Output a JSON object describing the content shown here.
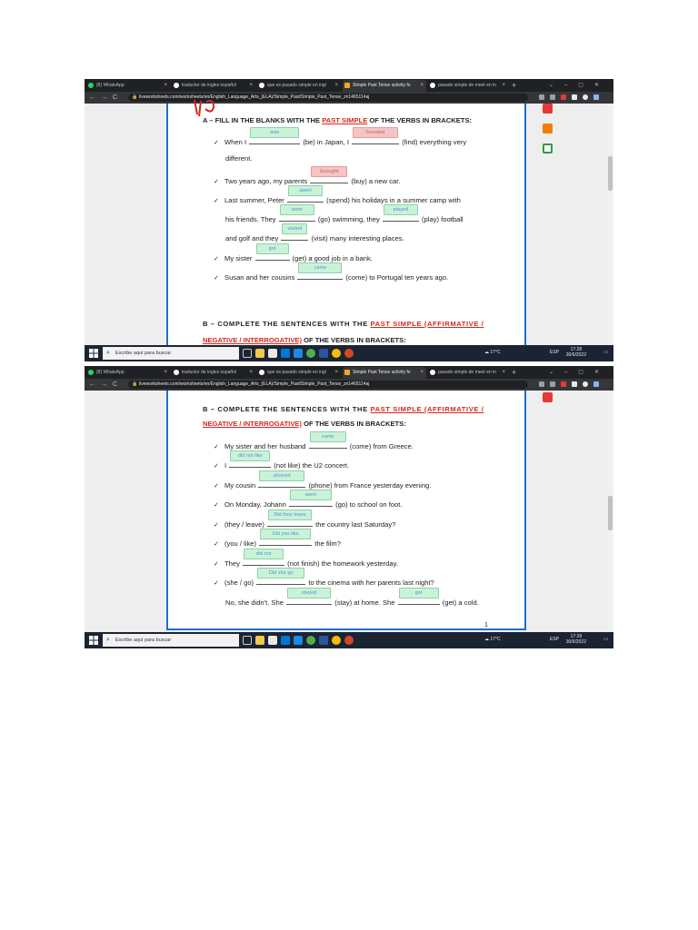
{
  "browser": {
    "tabs": [
      {
        "label": "(8) WhatsApp",
        "color": "#25d366"
      },
      {
        "label": "traductor de ingles español",
        "color": "#ffffff"
      },
      {
        "label": "que es pasado simple en ingl",
        "color": "#ffffff"
      },
      {
        "label": "Simple Past Tense activity fo",
        "color": "#f5a623",
        "active": true
      },
      {
        "label": "pasado simple de meet en in",
        "color": "#ffffff"
      }
    ],
    "new_tab": "+",
    "url": "liveworksheets.com/worksheets/en/English_Language_Arts_(ELA)/Simple_Past/Simple_Past_Tense_zn1465114aj"
  },
  "section_a": {
    "heading_prefix": "A – FILL IN THE BLANKS WITH THE ",
    "heading_red": "PAST SIMPLE",
    "heading_suffix": " OF THE VERBS IN BRACKETS:",
    "items": {
      "l1a": "When I",
      "a1": "was",
      "l1b": "(be) in Japan, I",
      "a2": "founded",
      "l1c": "(find) everything very",
      "l1d": "different.",
      "l2a": "Two years ago, my parents",
      "a3": "bouught",
      "l2b": "(buy) a new car.",
      "l3a": "Last summer, Peter",
      "a4": "spent",
      "l3b": "(spend) his holidays in a summer camp with",
      "l3c": "his friends. They",
      "a5": "went",
      "l3d": "(go) swimming, they",
      "a6": "played",
      "l3e": "(play) football",
      "l3f": "and golf and they",
      "a7": "visited",
      "l3g": "(visit) many interesting places.",
      "l4a": "My sister",
      "a8": "got",
      "l4b": "(get) a good job in a bank.",
      "l5a": "Susan and her cousins",
      "a9": "came",
      "l5b": "(come) to Portugal ten years ago."
    }
  },
  "section_b": {
    "heading1_prefix": "B – COMPLETE THE SENTENCES WITH THE ",
    "heading1_red": "PAST SIMPLE (AFFIRMATIVE /",
    "heading2_red": "NEGATIVE / INTERROGATIVE)",
    "heading2_suffix": " OF THE VERBS IN BRACKETS:",
    "items": {
      "b1a": "My sister and her husband",
      "b1ans": "came",
      "b1b": "(come) from Greece.",
      "b2a": "I",
      "b2ans": "did not like",
      "b2b": "(not like) the U2 concert.",
      "b3a": "My cousin",
      "b3ans": "phoned",
      "b3b": "(phone) from France yesterday evening.",
      "b4a": "On Monday, Johann",
      "b4ans": "went",
      "b4b": "(go) to school on foot.",
      "b5a": "(they / leave)",
      "b5ans": "Did they leave",
      "b5b": "the country last Saturday?",
      "b6a": "(you / like)",
      "b6ans": "Did you like",
      "b6b": "the film?",
      "b7a": "They",
      "b7ans": "did not",
      "b7b": "(not finish) the homework yesterday.",
      "b8a": "(she / go)",
      "b8ans": "Did she go",
      "b8b": "to the cinema with her parents last night?",
      "b9a": "No, she didn't. She",
      "b9ans": "stayed",
      "b9b": "(stay) at home. She",
      "b9ans2": "got",
      "b9c": "(get) a cold."
    },
    "page_number": "1"
  },
  "taskbar": {
    "search_placeholder": "Escribe aquí para buscar",
    "temperature": "17°C",
    "language": "ESP",
    "time": "17:28",
    "date": "30/6/2022"
  }
}
